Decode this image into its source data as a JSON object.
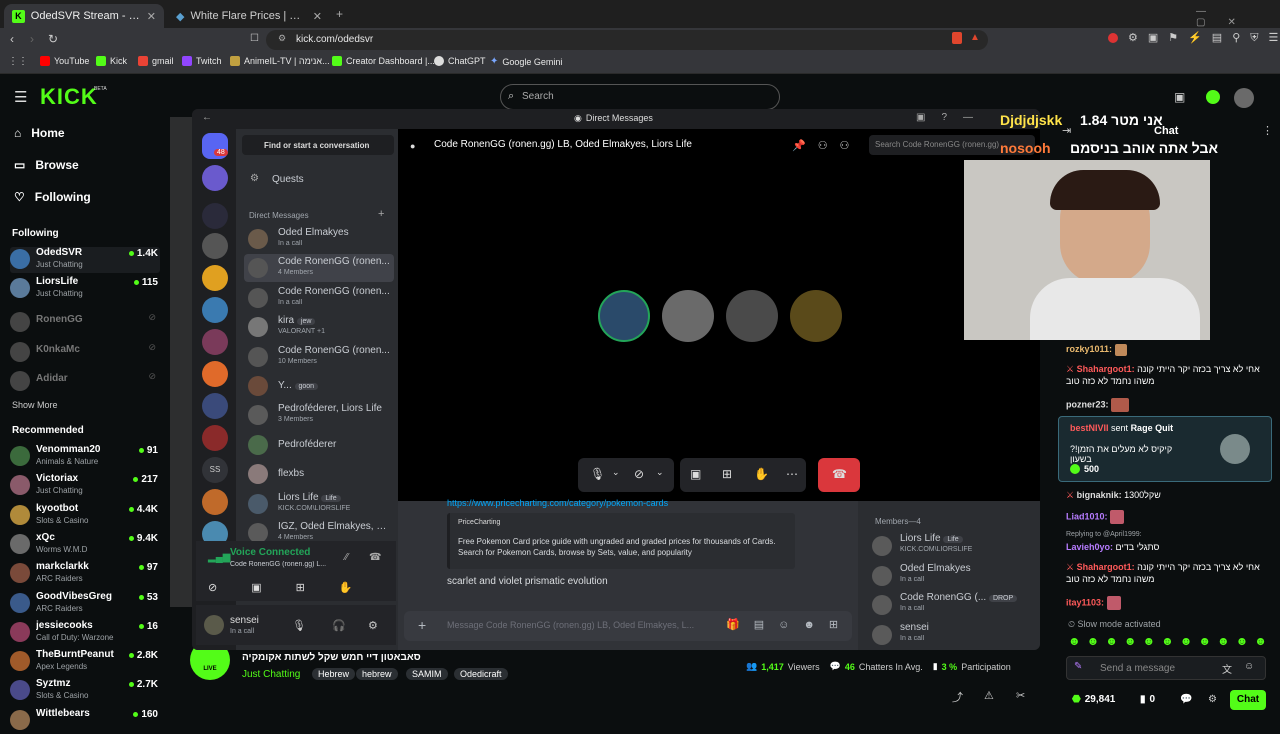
{
  "browser": {
    "tabs": [
      {
        "title": "OdedSVR Stream - Watch Live o"
      },
      {
        "title": "White Flare Prices | White Flare List"
      }
    ],
    "url": "kick.com/odedsvr",
    "bookmarks": [
      "YouTube",
      "Kick",
      "gmail",
      "Twitch",
      "AnimeIL-TV | אנימה...",
      "Creator Dashboard |...",
      "ChatGPT",
      "Google Gemini"
    ]
  },
  "kick": {
    "logo": "KICK",
    "beta": "BETA",
    "search_placeholder": "Search",
    "nav": {
      "home": "Home",
      "browse": "Browse",
      "following": "Following"
    },
    "following_header": "Following",
    "following": [
      {
        "name": "OdedSVR",
        "category": "Just Chatting",
        "viewers": "1.4K",
        "color": "#3a6ea5"
      },
      {
        "name": "LiorsLife",
        "category": "Just Chatting",
        "viewers": "115",
        "color": "#5a7a9a"
      },
      {
        "name": "RonenGG",
        "category": "",
        "viewers": "",
        "color": "#444"
      },
      {
        "name": "K0nkaMc",
        "category": "",
        "viewers": "",
        "color": "#444"
      },
      {
        "name": "Adidar",
        "category": "",
        "viewers": "",
        "color": "#444"
      }
    ],
    "show_more": "Show More",
    "recommended_header": "Recommended",
    "recommended": [
      {
        "name": "Venomman20",
        "category": "Animals & Nature",
        "viewers": "91",
        "color": "#3b6a3c"
      },
      {
        "name": "Victoriax",
        "category": "Just Chatting",
        "viewers": "217",
        "color": "#8a5a6a"
      },
      {
        "name": "kyootbot",
        "category": "Slots & Casino",
        "viewers": "4.4K",
        "color": "#b08a3a"
      },
      {
        "name": "xQc",
        "category": "Worms W.M.D",
        "viewers": "9.4K",
        "color": "#6a6a6a"
      },
      {
        "name": "markclarkk",
        "category": "ARC Raiders",
        "viewers": "97",
        "color": "#7a4a3a"
      },
      {
        "name": "GoodVibesGreg",
        "category": "ARC Raiders",
        "viewers": "53",
        "color": "#3a5a8a"
      },
      {
        "name": "jessiecooks",
        "category": "Call of Duty: Warzone",
        "viewers": "16",
        "color": "#8a3a5a"
      },
      {
        "name": "TheBurntPeanut",
        "category": "Apex Legends",
        "viewers": "2.8K",
        "color": "#a05a2a"
      },
      {
        "name": "Syztmz",
        "category": "Slots & Casino",
        "viewers": "2.7K",
        "color": "#4a4a8a"
      },
      {
        "name": "Wittlebears",
        "category": "",
        "viewers": "160",
        "color": "#8a6a4a"
      }
    ],
    "stream": {
      "title": "סאבאטון דיי חמש שקל לשתות אקומקיה",
      "category": "Just Chatting",
      "tags": [
        "Hebrew",
        "hebrew",
        "SAMIM",
        "Odedicraft"
      ],
      "viewers": "1,417",
      "viewers_label": "Viewers",
      "chatters": "46",
      "chatters_label": "Chatters In Avg.",
      "participation": "3 %",
      "participation_label": "Participation",
      "live": "LIVE"
    },
    "overlay": {
      "line1_user": "Djdjdjskk",
      "line1_text": "אני מטר 1.84",
      "line2_user": "nosooh",
      "line2_text": "אבל אתה אוהב בניסמם"
    }
  },
  "discord": {
    "title": "Direct Messages",
    "server_badge": "48",
    "find": "Find or start a conversation",
    "quests": "Quests",
    "dm_header": "Direct Messages",
    "dms": [
      {
        "name": "Oded Elmakyes",
        "sub": "In a call",
        "color": "#6a5a4a"
      },
      {
        "name": "Code RonenGG (ronen...",
        "sub": "4 Members",
        "color": "#555"
      },
      {
        "name": "Code RonenGG (ronen...",
        "sub": "In a call",
        "color": "#555"
      },
      {
        "name": "kira",
        "badge": "jew",
        "sub": "VALORANT +1",
        "color": "#777"
      },
      {
        "name": "Code RonenGG (ronen...",
        "sub": "10 Members",
        "color": "#555"
      },
      {
        "name": "Y...",
        "badge": "goon",
        "sub": "",
        "color": "#6a4a3a"
      },
      {
        "name": "Pedroféderer, Liors Life",
        "sub": "3 Members",
        "color": "#5a5a5a"
      },
      {
        "name": "Pedroféderer",
        "sub": "",
        "color": "#4a6a4a"
      },
      {
        "name": "flexbs",
        "sub": "",
        "color": "#8a7a7a"
      },
      {
        "name": "Liors Life",
        "badge": "Life",
        "sub": "KICK.COM\\LIORSLIFE",
        "color": "#4a5a6a"
      },
      {
        "name": "IGZ, Oded Elmakyes, P...",
        "sub": "4 Members",
        "color": "#5a5a5a"
      }
    ],
    "voice": {
      "status": "Voice Connected",
      "channel": "Code RonenGG (ronen.gg) L..."
    },
    "user": {
      "name": "sensei",
      "status": "In a call"
    },
    "call": {
      "title": "Code RonenGG (ronen.gg) LB, Oded Elmakyes, Liors Life",
      "search_placeholder": "Search Code RonenGG (ronen.gg)"
    },
    "message": {
      "link": "https://www.pricecharting.com/category/pokemon-cards",
      "embed_site": "PriceCharting",
      "embed_desc": "Free Pokemon Card price guide with ungraded and graded prices for thousands of Cards. Search for Pokemon Cards, browse by Sets, value, and popularity",
      "text": "scarlet and violet prismatic evolution"
    },
    "input_placeholder": "Message Code RonenGG (ronen.gg) LB, Oded Elmakyes, L...",
    "members_header": "Members—4",
    "members": [
      {
        "name": "Liors Life",
        "badge": "Life",
        "sub": "KICK.COM\\LIORSLIFE"
      },
      {
        "name": "Oded Elmakyes",
        "badge": "",
        "sub": "In a call"
      },
      {
        "name": "Code RonenGG (...",
        "badge": "DROP",
        "sub": "In a call"
      },
      {
        "name": "sensei",
        "badge": "",
        "sub": "In a call"
      }
    ]
  },
  "chat": {
    "title": "Chat",
    "messages": [
      {
        "user": "rozky1011:",
        "text": "",
        "color": "#e9b96e"
      },
      {
        "user": "Shahargoot1:",
        "text": "אחי לא צריך בכזה יקר הייתי קונה משהו נחמד לא כזה טוב",
        "color": "#ff5a5a"
      },
      {
        "user": "pozner23:",
        "text": "",
        "color": "#e0e0e0"
      },
      {
        "user": "Liad1010:",
        "text": "",
        "color": "#b77cff"
      },
      {
        "user": "Lavieh0yo:",
        "text": "סתגלי בדים",
        "color": "#b77cff"
      },
      {
        "user": "Shahargoot1:",
        "text": "אחי לא צריך בכזה יקר הייתי קונה משהו נחמד לא כזה טוב",
        "color": "#ff5a5a"
      },
      {
        "user": "itay1103:",
        "text": "",
        "color": "#ff5a5a"
      }
    ],
    "gift": {
      "user": "bestNIVII",
      "action": "sent",
      "item": "Rage Quit",
      "text": "?!קיקיס לא מעלים את הזמן בשעון",
      "amount": "500"
    },
    "bign": {
      "user": "bignaknik:",
      "text": "שקל1300"
    },
    "replying": "Replying to @April1999:",
    "slow_mode": "Slow mode activated",
    "input_placeholder": "Send a message",
    "points": "29,841",
    "points2": "0",
    "chat_button": "Chat"
  }
}
